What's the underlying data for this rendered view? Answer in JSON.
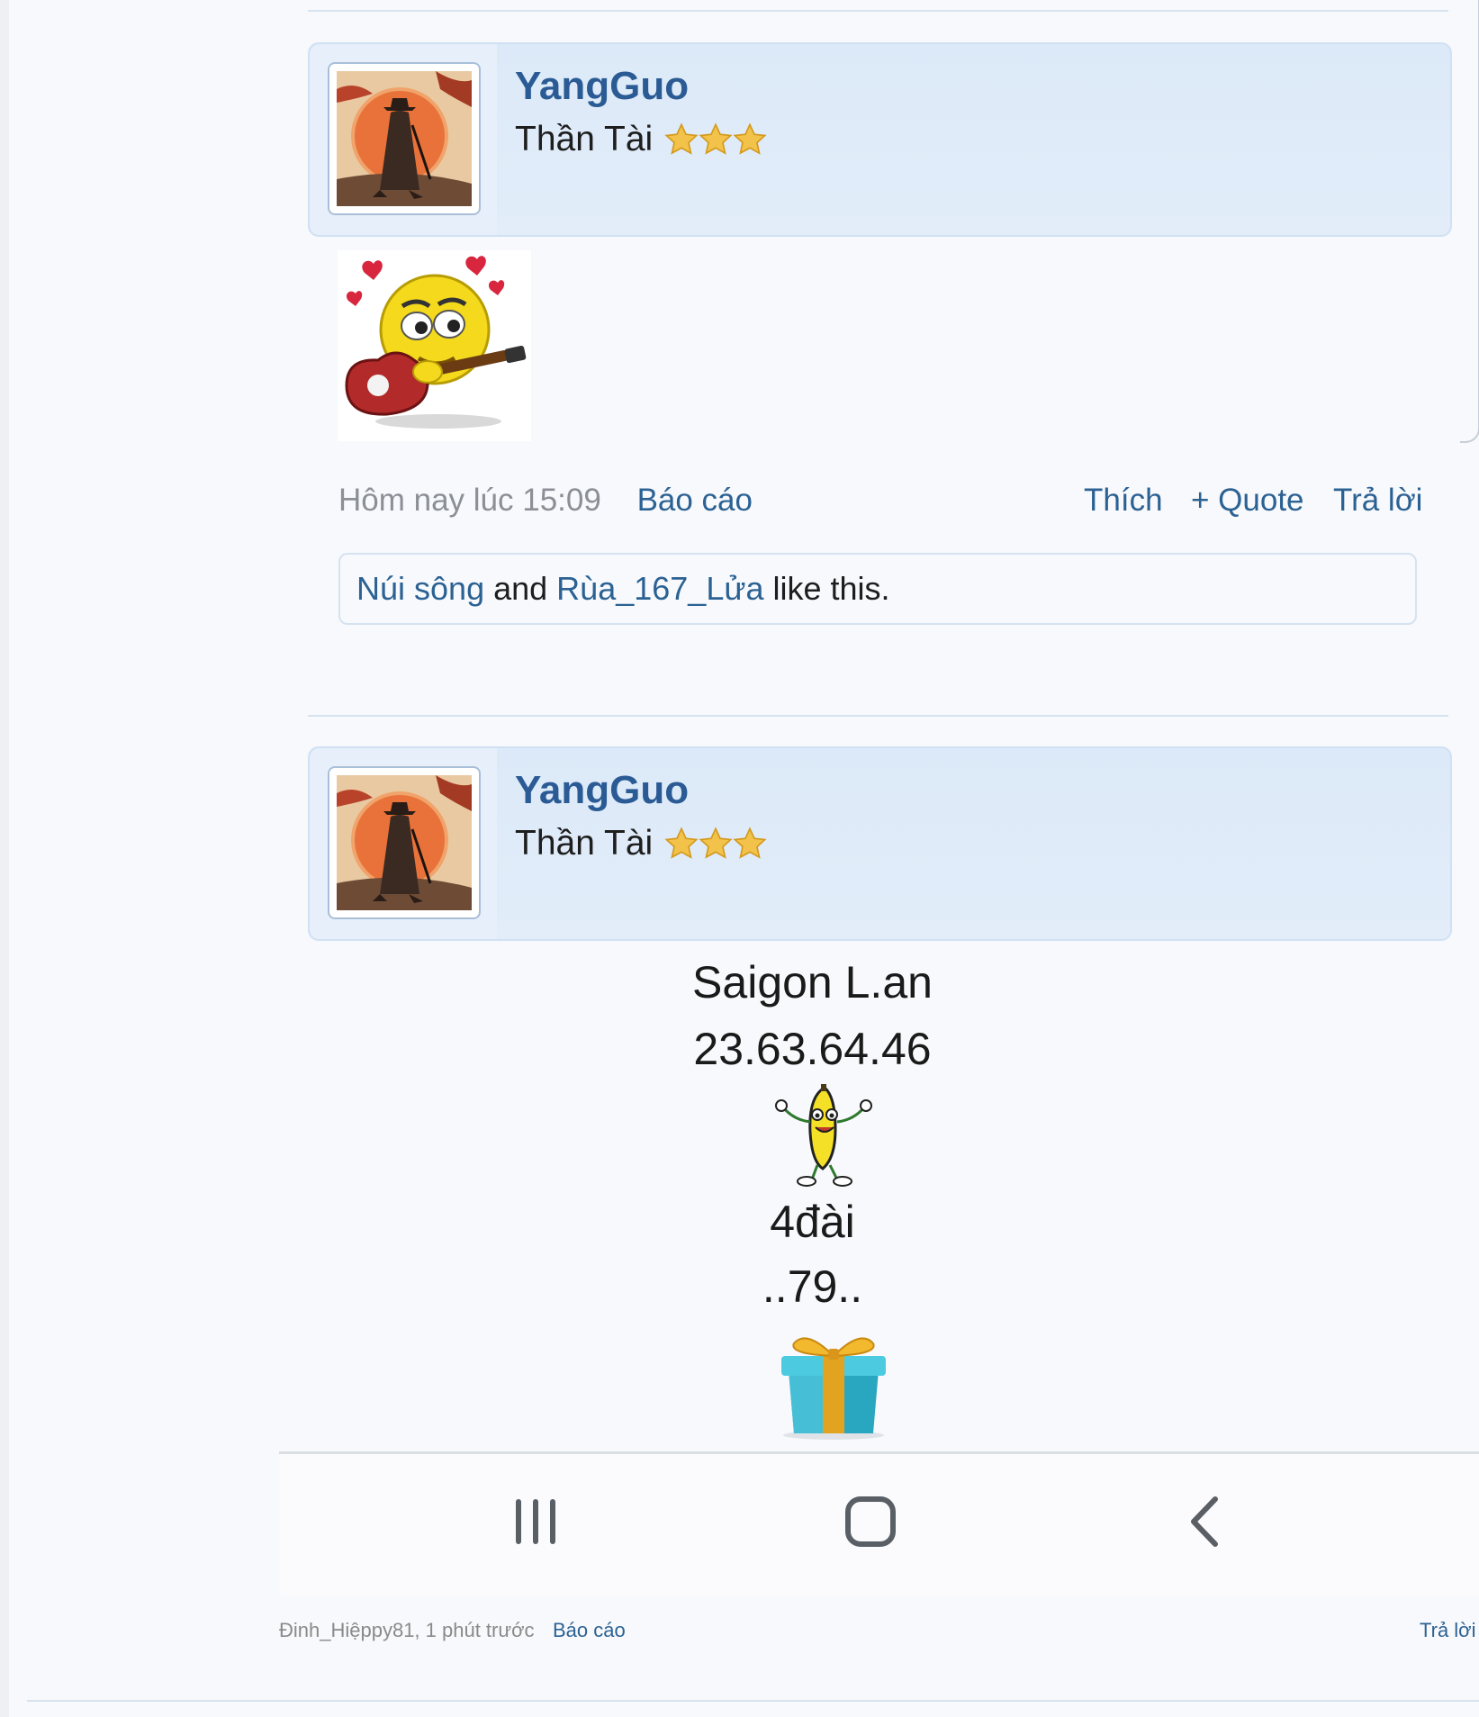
{
  "posts": [
    {
      "username": "YangGuo",
      "user_title": "Thần Tài",
      "stars": 3,
      "date": "Hôm nay lúc 15:09",
      "report_label": "Báo cáo",
      "like_label": "Thích",
      "quote_label": "+ Quote",
      "reply_label": "Trả lời",
      "likes": {
        "user1": "Núi sông",
        "connector": "and",
        "user2": "Rùa_167_Lửa",
        "suffix": "like this."
      }
    },
    {
      "username": "YangGuo",
      "user_title": "Thần Tài",
      "stars": 3,
      "content": {
        "line1": "Saigon L.an",
        "line2": "23.63.64.46",
        "line3": "4đài",
        "line4": "..79.."
      }
    }
  ],
  "navbar": {
    "recents": "recents-icon",
    "home": "home-icon",
    "back": "back-icon"
  },
  "footer": {
    "author_time": "Đinh_Hiệppy81, 1 phút trước",
    "report_label": "Báo cáo",
    "reply_label": "Trả lời"
  },
  "colors": {
    "link": "#2c6293",
    "username": "#2b5b94",
    "header_bg": "#dce9f8"
  }
}
